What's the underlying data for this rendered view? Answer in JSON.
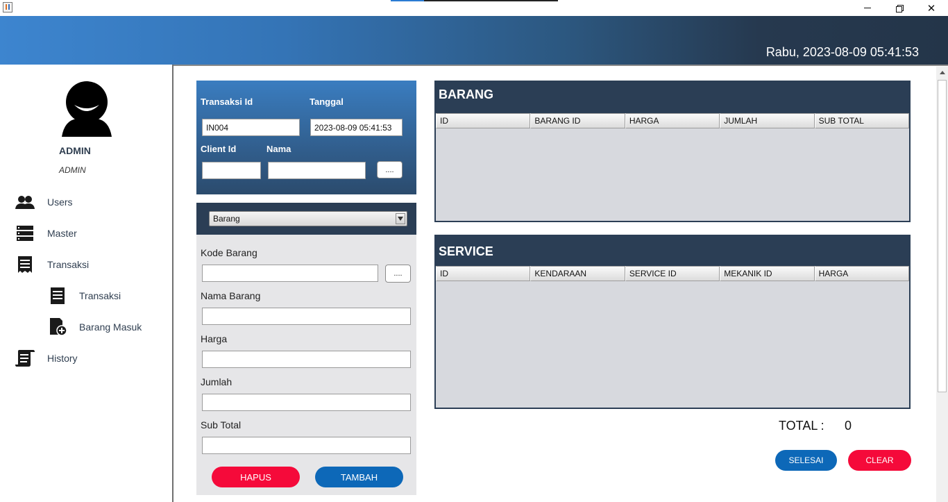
{
  "window": {
    "minimize_symbol": "",
    "close_symbol": "✕"
  },
  "header": {
    "datetime": "Rabu, 2023-08-09 05:41:53"
  },
  "sidebar": {
    "user_name": "ADMIN",
    "user_role": "ADMIN",
    "items": [
      {
        "label": "Users",
        "icon": "users-icon"
      },
      {
        "label": "Master",
        "icon": "server-icon"
      },
      {
        "label": "Transaksi",
        "icon": "receipt-icon"
      },
      {
        "label": "Transaksi",
        "icon": "receipt-icon"
      },
      {
        "label": "Barang Masuk",
        "icon": "document-add-icon"
      },
      {
        "label": "History",
        "icon": "scroll-icon"
      }
    ]
  },
  "transaction": {
    "id_label": "Transaksi Id",
    "id_value": "IN004",
    "date_label": "Tanggal",
    "date_value": "2023-08-09 05:41:53",
    "client_label": "Client Id",
    "client_value": "",
    "name_label": "Nama",
    "name_value": "",
    "lookup_label": "...."
  },
  "item_form": {
    "type_selected": "Barang",
    "code_label": "Kode Barang",
    "code_value": "",
    "code_lookup_label": "....",
    "name_label": "Nama Barang",
    "name_value": "",
    "price_label": "Harga",
    "price_value": "",
    "qty_label": "Jumlah",
    "qty_value": "",
    "subtotal_label": "Sub Total",
    "subtotal_value": "",
    "delete_label": "HAPUS",
    "add_label": "TAMBAH"
  },
  "barang_table": {
    "title": "BARANG",
    "columns": [
      "ID",
      "BARANG ID",
      "HARGA",
      "JUMLAH",
      "SUB TOTAL"
    ],
    "rows": []
  },
  "service_table": {
    "title": "SERVICE",
    "columns": [
      "ID",
      "KENDARAAN",
      "SERVICE ID",
      "MEKANIK ID",
      "HARGA"
    ],
    "rows": []
  },
  "summary": {
    "total_label": "TOTAL :",
    "total_value": "0",
    "finish_label": "SELESAI",
    "clear_label": "CLEAR"
  },
  "colors": {
    "banner_start": "#3d85cf",
    "banner_end": "#243549",
    "panel_dark": "#2b3e55",
    "button_red": "#f50a3a",
    "button_blue": "#0d68b8"
  }
}
